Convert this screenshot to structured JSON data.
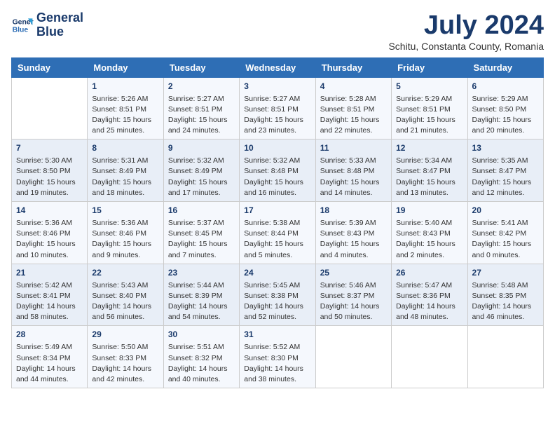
{
  "logo": {
    "line1": "General",
    "line2": "Blue"
  },
  "title": "July 2024",
  "subtitle": "Schitu, Constanta County, Romania",
  "weekdays": [
    "Sunday",
    "Monday",
    "Tuesday",
    "Wednesday",
    "Thursday",
    "Friday",
    "Saturday"
  ],
  "weeks": [
    [
      {
        "day": "",
        "info": ""
      },
      {
        "day": "1",
        "info": "Sunrise: 5:26 AM\nSunset: 8:51 PM\nDaylight: 15 hours\nand 25 minutes."
      },
      {
        "day": "2",
        "info": "Sunrise: 5:27 AM\nSunset: 8:51 PM\nDaylight: 15 hours\nand 24 minutes."
      },
      {
        "day": "3",
        "info": "Sunrise: 5:27 AM\nSunset: 8:51 PM\nDaylight: 15 hours\nand 23 minutes."
      },
      {
        "day": "4",
        "info": "Sunrise: 5:28 AM\nSunset: 8:51 PM\nDaylight: 15 hours\nand 22 minutes."
      },
      {
        "day": "5",
        "info": "Sunrise: 5:29 AM\nSunset: 8:51 PM\nDaylight: 15 hours\nand 21 minutes."
      },
      {
        "day": "6",
        "info": "Sunrise: 5:29 AM\nSunset: 8:50 PM\nDaylight: 15 hours\nand 20 minutes."
      }
    ],
    [
      {
        "day": "7",
        "info": "Sunrise: 5:30 AM\nSunset: 8:50 PM\nDaylight: 15 hours\nand 19 minutes."
      },
      {
        "day": "8",
        "info": "Sunrise: 5:31 AM\nSunset: 8:49 PM\nDaylight: 15 hours\nand 18 minutes."
      },
      {
        "day": "9",
        "info": "Sunrise: 5:32 AM\nSunset: 8:49 PM\nDaylight: 15 hours\nand 17 minutes."
      },
      {
        "day": "10",
        "info": "Sunrise: 5:32 AM\nSunset: 8:48 PM\nDaylight: 15 hours\nand 16 minutes."
      },
      {
        "day": "11",
        "info": "Sunrise: 5:33 AM\nSunset: 8:48 PM\nDaylight: 15 hours\nand 14 minutes."
      },
      {
        "day": "12",
        "info": "Sunrise: 5:34 AM\nSunset: 8:47 PM\nDaylight: 15 hours\nand 13 minutes."
      },
      {
        "day": "13",
        "info": "Sunrise: 5:35 AM\nSunset: 8:47 PM\nDaylight: 15 hours\nand 12 minutes."
      }
    ],
    [
      {
        "day": "14",
        "info": "Sunrise: 5:36 AM\nSunset: 8:46 PM\nDaylight: 15 hours\nand 10 minutes."
      },
      {
        "day": "15",
        "info": "Sunrise: 5:36 AM\nSunset: 8:46 PM\nDaylight: 15 hours\nand 9 minutes."
      },
      {
        "day": "16",
        "info": "Sunrise: 5:37 AM\nSunset: 8:45 PM\nDaylight: 15 hours\nand 7 minutes."
      },
      {
        "day": "17",
        "info": "Sunrise: 5:38 AM\nSunset: 8:44 PM\nDaylight: 15 hours\nand 5 minutes."
      },
      {
        "day": "18",
        "info": "Sunrise: 5:39 AM\nSunset: 8:43 PM\nDaylight: 15 hours\nand 4 minutes."
      },
      {
        "day": "19",
        "info": "Sunrise: 5:40 AM\nSunset: 8:43 PM\nDaylight: 15 hours\nand 2 minutes."
      },
      {
        "day": "20",
        "info": "Sunrise: 5:41 AM\nSunset: 8:42 PM\nDaylight: 15 hours\nand 0 minutes."
      }
    ],
    [
      {
        "day": "21",
        "info": "Sunrise: 5:42 AM\nSunset: 8:41 PM\nDaylight: 14 hours\nand 58 minutes."
      },
      {
        "day": "22",
        "info": "Sunrise: 5:43 AM\nSunset: 8:40 PM\nDaylight: 14 hours\nand 56 minutes."
      },
      {
        "day": "23",
        "info": "Sunrise: 5:44 AM\nSunset: 8:39 PM\nDaylight: 14 hours\nand 54 minutes."
      },
      {
        "day": "24",
        "info": "Sunrise: 5:45 AM\nSunset: 8:38 PM\nDaylight: 14 hours\nand 52 minutes."
      },
      {
        "day": "25",
        "info": "Sunrise: 5:46 AM\nSunset: 8:37 PM\nDaylight: 14 hours\nand 50 minutes."
      },
      {
        "day": "26",
        "info": "Sunrise: 5:47 AM\nSunset: 8:36 PM\nDaylight: 14 hours\nand 48 minutes."
      },
      {
        "day": "27",
        "info": "Sunrise: 5:48 AM\nSunset: 8:35 PM\nDaylight: 14 hours\nand 46 minutes."
      }
    ],
    [
      {
        "day": "28",
        "info": "Sunrise: 5:49 AM\nSunset: 8:34 PM\nDaylight: 14 hours\nand 44 minutes."
      },
      {
        "day": "29",
        "info": "Sunrise: 5:50 AM\nSunset: 8:33 PM\nDaylight: 14 hours\nand 42 minutes."
      },
      {
        "day": "30",
        "info": "Sunrise: 5:51 AM\nSunset: 8:32 PM\nDaylight: 14 hours\nand 40 minutes."
      },
      {
        "day": "31",
        "info": "Sunrise: 5:52 AM\nSunset: 8:30 PM\nDaylight: 14 hours\nand 38 minutes."
      },
      {
        "day": "",
        "info": ""
      },
      {
        "day": "",
        "info": ""
      },
      {
        "day": "",
        "info": ""
      }
    ]
  ]
}
